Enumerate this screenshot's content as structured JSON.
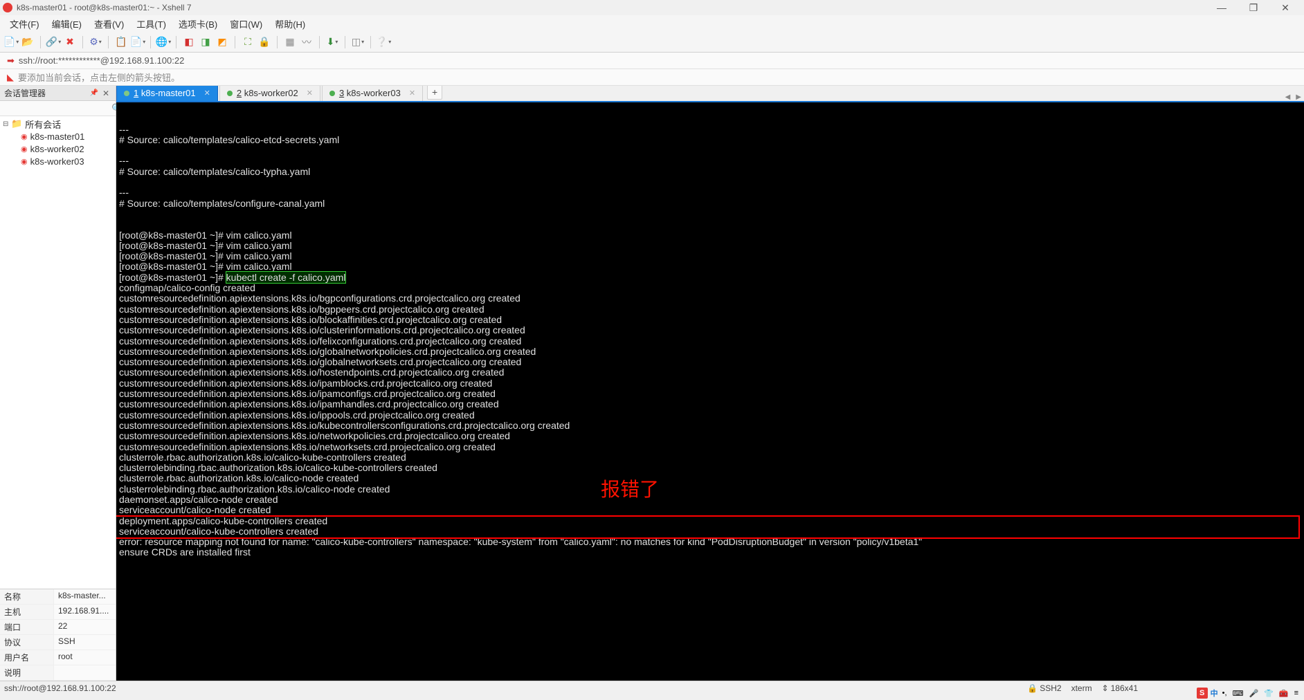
{
  "window": {
    "title": "k8s-master01 - root@k8s-master01:~ - Xshell 7",
    "minimize": "—",
    "maximize": "❐",
    "close": "✕"
  },
  "menu": {
    "file": "文件(F)",
    "edit": "编辑(E)",
    "view": "查看(V)",
    "tools": "工具(T)",
    "tab": "选项卡(B)",
    "window": "窗口(W)",
    "help": "帮助(H)"
  },
  "address": "ssh://root:************@192.168.91.100:22",
  "hint": "要添加当前会话，点击左侧的箭头按钮。",
  "sidebar": {
    "title": "会话管理器",
    "search_ph": "",
    "root": "所有会话",
    "items": [
      "k8s-master01",
      "k8s-worker02",
      "k8s-worker03"
    ]
  },
  "props": {
    "name_k": "名称",
    "name_v": "k8s-master...",
    "host_k": "主机",
    "host_v": "192.168.91....",
    "port_k": "端口",
    "port_v": "22",
    "proto_k": "协议",
    "proto_v": "SSH",
    "user_k": "用户名",
    "user_v": "root",
    "desc_k": "说明",
    "desc_v": ""
  },
  "tabs": [
    {
      "num": "1",
      "label": "k8s-master01",
      "active": true
    },
    {
      "num": "2",
      "label": "k8s-worker02",
      "active": false
    },
    {
      "num": "3",
      "label": "k8s-worker03",
      "active": false
    }
  ],
  "terminal": {
    "prompt": "[root@k8s-master01 ~]#",
    "cmd_vim": "vim calico.yaml",
    "cmd_kubectl": "kubectl create -f calico.yaml",
    "lines": [
      "---",
      "# Source: calico/templates/calico-etcd-secrets.yaml",
      "",
      "---",
      "# Source: calico/templates/calico-typha.yaml",
      "",
      "---",
      "# Source: calico/templates/configure-canal.yaml",
      "",
      "",
      "[root@k8s-master01 ~]# vim calico.yaml",
      "[root@k8s-master01 ~]# vim calico.yaml",
      "[root@k8s-master01 ~]# vim calico.yaml",
      "[root@k8s-master01 ~]# vim calico.yaml",
      "",
      "configmap/calico-config created",
      "customresourcedefinition.apiextensions.k8s.io/bgpconfigurations.crd.projectcalico.org created",
      "customresourcedefinition.apiextensions.k8s.io/bgppeers.crd.projectcalico.org created",
      "customresourcedefinition.apiextensions.k8s.io/blockaffinities.crd.projectcalico.org created",
      "customresourcedefinition.apiextensions.k8s.io/clusterinformations.crd.projectcalico.org created",
      "customresourcedefinition.apiextensions.k8s.io/felixconfigurations.crd.projectcalico.org created",
      "customresourcedefinition.apiextensions.k8s.io/globalnetworkpolicies.crd.projectcalico.org created",
      "customresourcedefinition.apiextensions.k8s.io/globalnetworksets.crd.projectcalico.org created",
      "customresourcedefinition.apiextensions.k8s.io/hostendpoints.crd.projectcalico.org created",
      "customresourcedefinition.apiextensions.k8s.io/ipamblocks.crd.projectcalico.org created",
      "customresourcedefinition.apiextensions.k8s.io/ipamconfigs.crd.projectcalico.org created",
      "customresourcedefinition.apiextensions.k8s.io/ipamhandles.crd.projectcalico.org created",
      "customresourcedefinition.apiextensions.k8s.io/ippools.crd.projectcalico.org created",
      "customresourcedefinition.apiextensions.k8s.io/kubecontrollersconfigurations.crd.projectcalico.org created",
      "customresourcedefinition.apiextensions.k8s.io/networkpolicies.crd.projectcalico.org created",
      "customresourcedefinition.apiextensions.k8s.io/networksets.crd.projectcalico.org created",
      "clusterrole.rbac.authorization.k8s.io/calico-kube-controllers created",
      "clusterrolebinding.rbac.authorization.k8s.io/calico-kube-controllers created",
      "clusterrole.rbac.authorization.k8s.io/calico-node created",
      "clusterrolebinding.rbac.authorization.k8s.io/calico-node created",
      "daemonset.apps/calico-node created",
      "serviceaccount/calico-node created",
      "deployment.apps/calico-kube-controllers created",
      "serviceaccount/calico-kube-controllers created",
      "error: resource mapping not found for name: \"calico-kube-controllers\" namespace: \"kube-system\" from \"calico.yaml\": no matches for kind \"PodDisruptionBudget\" in version \"policy/v1beta1\"",
      "ensure CRDs are installed first"
    ],
    "annotation": "报错了"
  },
  "status": {
    "left": "ssh://root@192.168.91.100:22",
    "proto": "SSH2",
    "term": "xterm",
    "size": "186x41"
  },
  "tray": {
    "ime": "S",
    "cn": "中"
  }
}
